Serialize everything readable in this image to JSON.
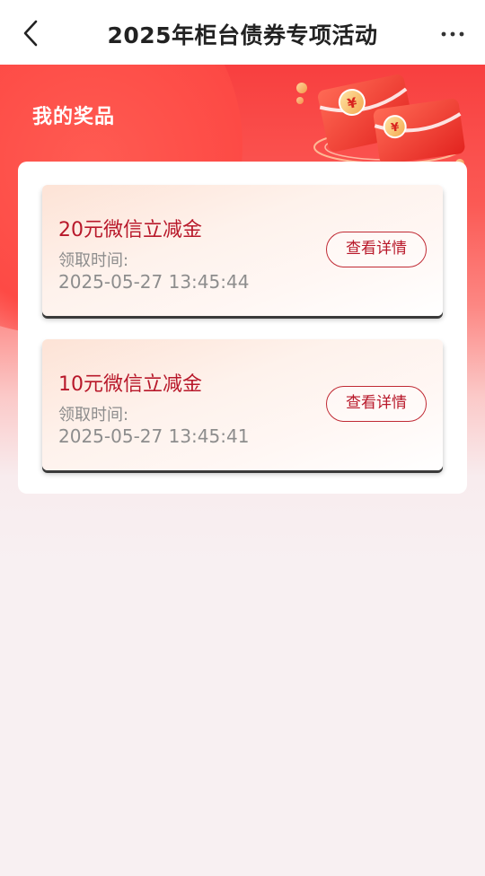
{
  "navbar": {
    "title": "2025年柜台债券专项活动",
    "back_icon": "chevron-left-icon",
    "more_icon": "more-dots-icon"
  },
  "hero": {
    "title": "我的奖品",
    "illustration": "red-envelope-illustration"
  },
  "prizes": [
    {
      "name": "20元微信立减金",
      "time_label": "领取时间:",
      "time_value": "2025-05-27 13:45:44",
      "button_label": "查看详情"
    },
    {
      "name": "10元微信立减金",
      "time_label": "领取时间:",
      "time_value": "2025-05-27 13:45:41",
      "button_label": "查看详情"
    }
  ],
  "colors": {
    "brand_red": "#f83f3f",
    "prize_text": "#b8182a",
    "secondary_text": "#8d8d8d"
  }
}
